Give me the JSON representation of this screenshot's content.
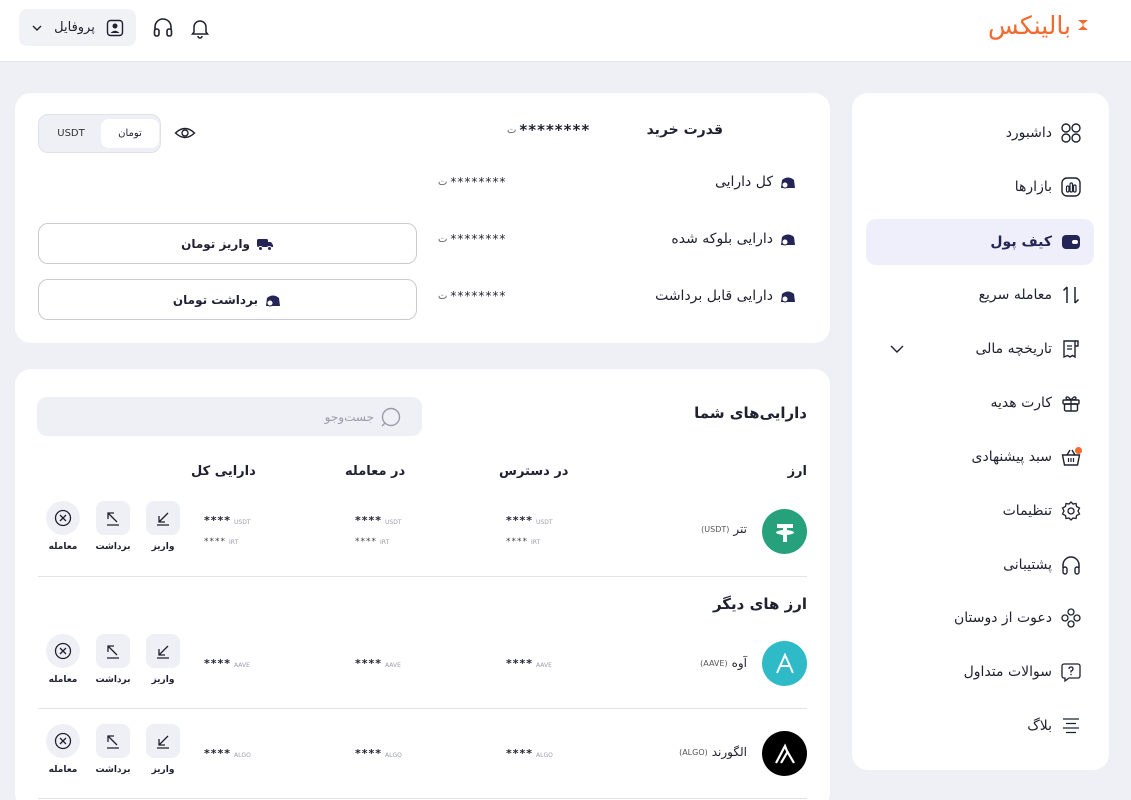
{
  "header": {
    "brand": "بالینکس",
    "profile_label": "پروفایل"
  },
  "sidebar": {
    "items": [
      {
        "label": "داشبورد",
        "icon": "dashboard-icon"
      },
      {
        "label": "بازارها",
        "icon": "markets-icon"
      },
      {
        "label": "کیف پول",
        "icon": "wallet-icon",
        "active": true
      },
      {
        "label": "معامله سریع",
        "icon": "swap-icon"
      },
      {
        "label": "تاریخچه مالی",
        "icon": "receipt-icon"
      },
      {
        "label": "کارت هدیه",
        "icon": "gift-icon"
      },
      {
        "label": "سبد پیشنهادی",
        "icon": "basket-icon"
      },
      {
        "label": "تنظیمات",
        "icon": "gear-icon"
      },
      {
        "label": "پشتیبانی",
        "icon": "headset-icon"
      },
      {
        "label": "دعوت از دوستان",
        "icon": "users-icon"
      },
      {
        "label": "سوالات متداول",
        "icon": "question-icon"
      },
      {
        "label": "بلاگ",
        "icon": "blog-icon"
      }
    ]
  },
  "summary": {
    "toggle": {
      "toman": "تومان",
      "usdt": "USDT"
    },
    "buying_power_label": "قدرت خرید",
    "buying_power_value": "********",
    "total_label": "کل دارایی",
    "total_value": "********",
    "blocked_label": "دارایی بلوکه شده",
    "blocked_value": "********",
    "withdrawable_label": "دارایی قابل برداشت",
    "withdrawable_value": "********",
    "deposit_button": "واریز تومان",
    "withdraw_button": "برداشت تومان"
  },
  "assets": {
    "title": "دارایی‌های شما",
    "search_placeholder": "جست‌وجو",
    "columns": {
      "coin": "ارز",
      "available": "در دسترس",
      "in_trade": "در معامله",
      "total": "دارایی کل"
    },
    "actions": {
      "deposit": "واریز",
      "withdraw": "برداشت",
      "trade": "معامله"
    },
    "mine": {
      "name": "تتر",
      "symbol": "(USDT)",
      "color": "#26a17b",
      "available": "****",
      "available_unit": "USDT",
      "available_sub": "****",
      "available_sub_unit": "IRT",
      "in_trade": "****",
      "in_trade_unit": "USDT",
      "in_trade_sub": "****",
      "in_trade_sub_unit": "IRT",
      "total": "****",
      "total_unit": "USDT",
      "total_sub": "****",
      "total_sub_unit": "IRT"
    },
    "others_title": "ارز های دیگر",
    "others": [
      {
        "name": "آوه",
        "symbol": "(AAVE)",
        "color": "#2ebac6",
        "available": "****",
        "in_trade": "****",
        "total": "****",
        "unit": "AAVE"
      },
      {
        "name": "الگورند",
        "symbol": "(ALGO)",
        "color": "#000000",
        "available": "****",
        "in_trade": "****",
        "total": "****",
        "unit": "ALGO"
      }
    ]
  }
}
